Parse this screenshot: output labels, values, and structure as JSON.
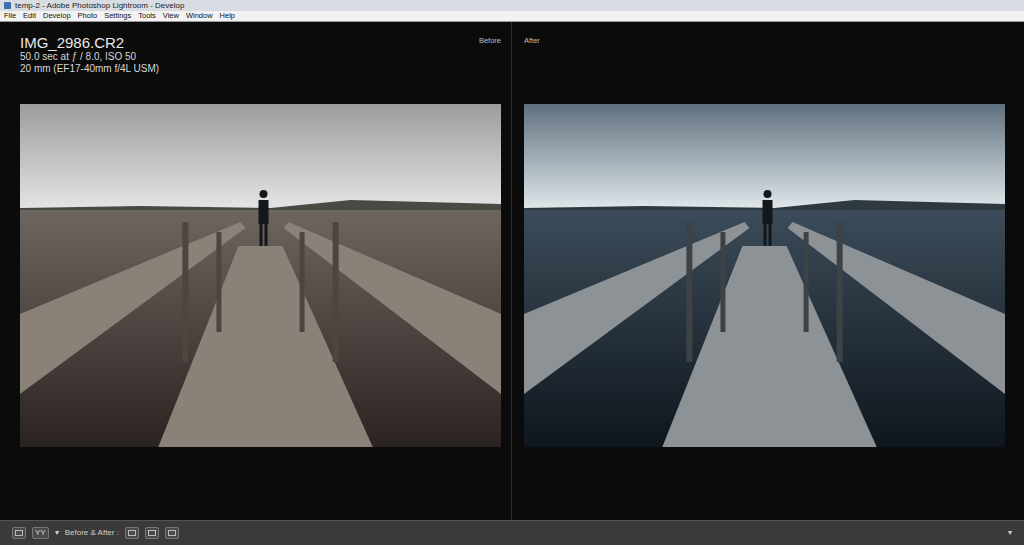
{
  "window": {
    "title": "temp-2 - Adobe Photoshop Lightroom - Develop"
  },
  "menu": [
    "File",
    "Edit",
    "Develop",
    "Photo",
    "Settings",
    "Tools",
    "View",
    "Window",
    "Help"
  ],
  "info": {
    "filename": "IMG_2986.CR2",
    "exposure": "50.0 sec at ƒ / 8.0, ISO 50",
    "lens": "20 mm (EF17-40mm f/4L USM)"
  },
  "panes": [
    {
      "label": "Before",
      "kind": "before"
    },
    {
      "label": "After",
      "kind": "after"
    }
  ],
  "toolbar": {
    "view_mode": "YY",
    "mode_arrow": "▾",
    "label": "Before & After :",
    "menu_arrow": "▾"
  }
}
